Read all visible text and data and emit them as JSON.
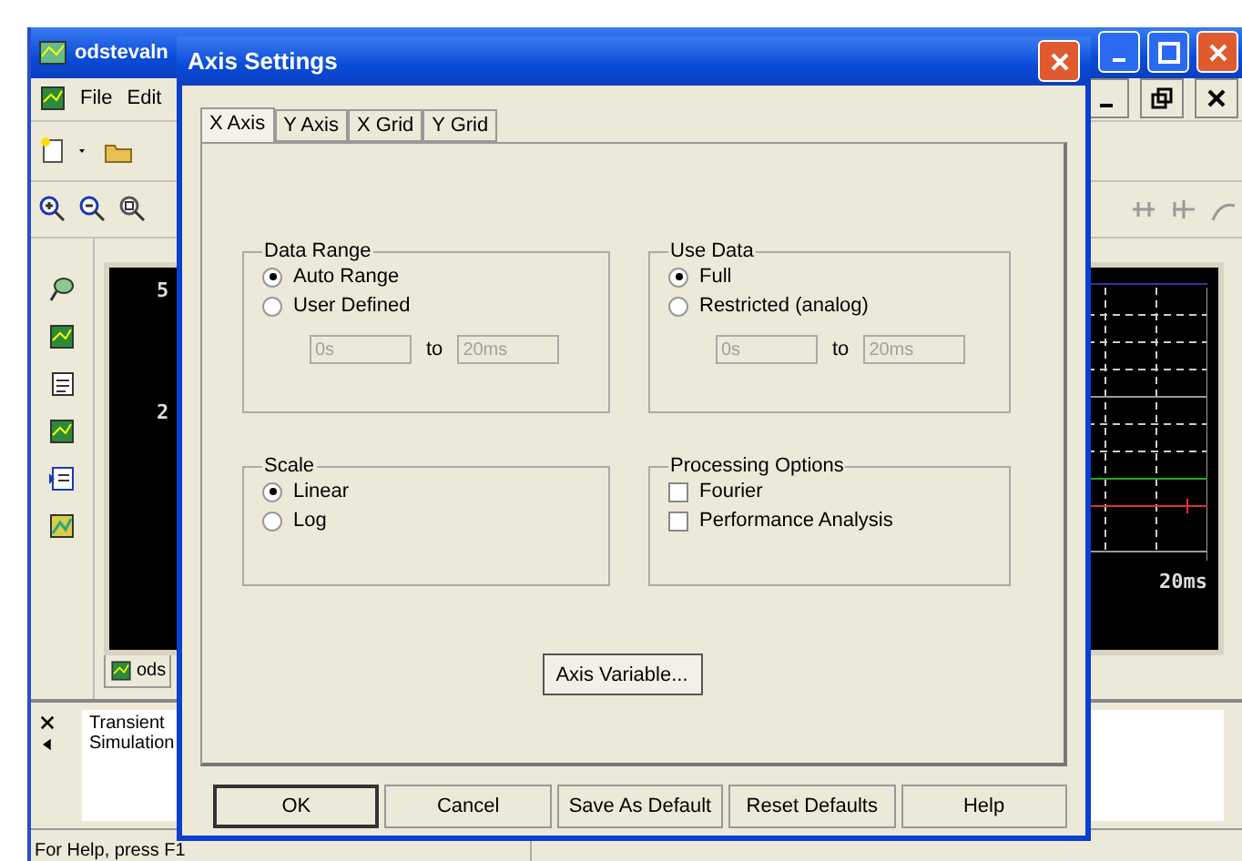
{
  "app": {
    "title": "odstevaln",
    "menu": [
      {
        "label": "File"
      },
      {
        "label": "Edit"
      }
    ],
    "plot": {
      "y_labels": [
        "5",
        "2"
      ],
      "x_label": "20ms"
    },
    "doc_tab": "ods",
    "output": {
      "lines": [
        "Transient",
        "Simulation"
      ]
    },
    "status_bar": [
      "For Help, press F1"
    ]
  },
  "dialog": {
    "title": "Axis Settings",
    "tabs": [
      {
        "label": "X Axis",
        "selected": true
      },
      {
        "label": "Y Axis",
        "selected": false
      },
      {
        "label": "X Grid",
        "selected": false
      },
      {
        "label": "Y Grid",
        "selected": false
      }
    ],
    "data_range": {
      "title": "Data Range",
      "disabled": true,
      "from": "0s",
      "to_label": "to",
      "to": "20ms",
      "options": [
        {
          "label": "Auto Range",
          "selected": true
        },
        {
          "label": "User Defined",
          "selected": false
        }
      ]
    },
    "use_data": {
      "title": "Use Data",
      "disabled": true,
      "from": "0s",
      "to_label": "to",
      "to": "20ms",
      "options": [
        {
          "label": "Full",
          "selected": true
        },
        {
          "label": "Restricted (analog)",
          "selected": false
        }
      ]
    },
    "scale": {
      "title": "Scale",
      "options": [
        {
          "label": "Linear",
          "selected": true
        },
        {
          "label": "Log",
          "selected": false
        }
      ]
    },
    "processing": {
      "title": "Processing Options",
      "options": [
        {
          "label": "Fourier",
          "checked": false
        },
        {
          "label": "Performance Analysis",
          "checked": false
        }
      ]
    },
    "axis_variable_button": "Axis Variable...",
    "buttons": [
      {
        "label": "OK",
        "default": true
      },
      {
        "label": "Cancel",
        "default": false
      },
      {
        "label": "Save As Default",
        "default": false
      },
      {
        "label": "Reset Defaults",
        "default": false
      },
      {
        "label": "Help",
        "default": false
      }
    ]
  }
}
